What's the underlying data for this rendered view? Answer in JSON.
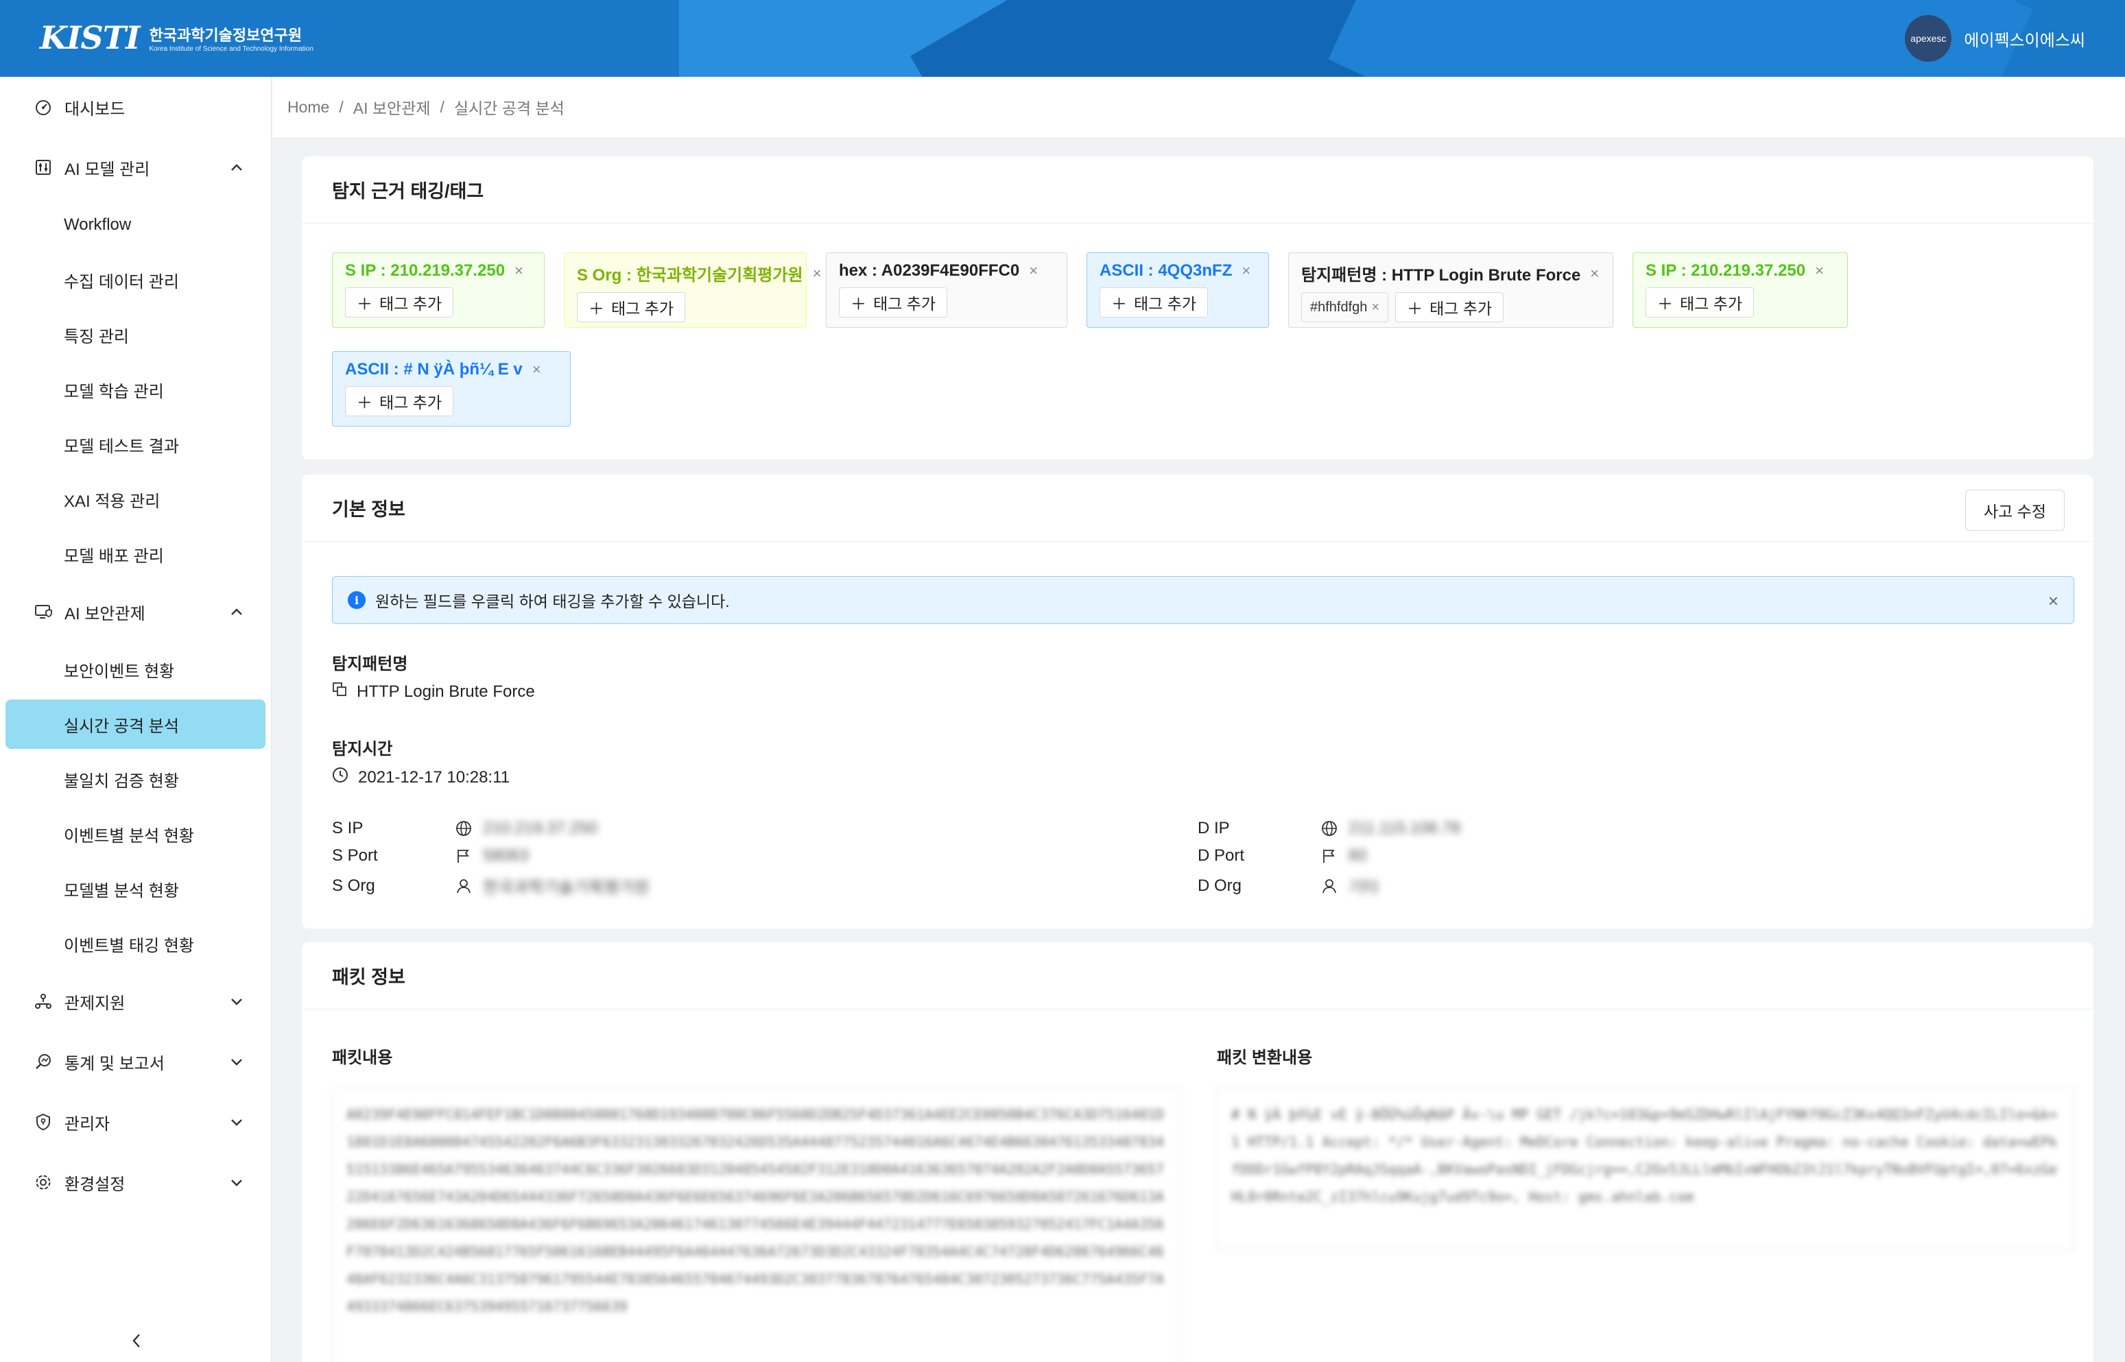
{
  "header": {
    "logo_mark": "KISTI",
    "org_ko": "한국과학기술정보연구원",
    "org_en": "Korea Institute of Science and Technology Information",
    "avatar_text": "apexesc",
    "user_name": "에이펙스이에스씨"
  },
  "sidebar": {
    "items": [
      {
        "label": "대시보드",
        "icon": "dashboard-icon"
      },
      {
        "label": "AI 모델 관리",
        "icon": "sliders-icon",
        "expanded": true,
        "children": [
          "Workflow",
          "수집 데이터 관리",
          "특징 관리",
          "모델 학습 관리",
          "모델 테스트 결과",
          "XAI 적용 관리",
          "모델 배포 관리"
        ]
      },
      {
        "label": "AI 보안관제",
        "icon": "monitor-shield-icon",
        "expanded": true,
        "children": [
          "보안이벤트 현황",
          "실시간 공격 분석",
          "불일치 검증 현황",
          "이벤트별 분석 현황",
          "모델별 분석 현황",
          "이벤트별 태깅 현황"
        ]
      },
      {
        "label": "관제지원",
        "icon": "network-icon",
        "expanded": false
      },
      {
        "label": "통계 및 보고서",
        "icon": "search-chart-icon",
        "expanded": false
      },
      {
        "label": "관리자",
        "icon": "shield-icon",
        "expanded": false
      },
      {
        "label": "환경설정",
        "icon": "gear-icon",
        "expanded": false
      }
    ],
    "active": "실시간 공격 분석"
  },
  "breadcrumb": [
    "Home",
    "AI 보안관제",
    "실시간 공격 분석"
  ],
  "tags_card": {
    "title": "탐지 근거 태깅/태그",
    "add_label": "태그 추가",
    "tags": [
      {
        "title": "S IP : 210.219.37.250",
        "color": "green"
      },
      {
        "title": "S Org : 한국과학기술기획평가원",
        "color": "yellow"
      },
      {
        "title": "hex : A0239F4E90FFC0",
        "color": "white"
      },
      {
        "title": "ASCII : 4QQ3nFZ",
        "color": "blue"
      },
      {
        "title": "탐지패턴명 : HTTP Login Brute Force",
        "color": "white",
        "chips": [
          "#hfhfdfgh"
        ]
      },
      {
        "title": "S IP : 210.219.37.250",
        "color": "green"
      },
      {
        "title": "ASCII : #  N  ÿÀ þñ¼ E v",
        "color": "blue"
      }
    ]
  },
  "basic_card": {
    "title": "기본 정보",
    "edit_label": "사고 수정",
    "alert": "원하는 필드를 우클릭 하여 태깅을 추가할 수 있습니다.",
    "pattern_label": "탐지패턴명",
    "pattern_value": "HTTP Login Brute Force",
    "time_label": "탐지시간",
    "time_value": "2021-12-17 10:28:11",
    "left": [
      {
        "k": "S IP",
        "icon": "globe-icon",
        "v": "210.219.37.250"
      },
      {
        "k": "S Port",
        "icon": "flag-icon",
        "v": "58063"
      },
      {
        "k": "S Org",
        "icon": "user-icon",
        "v": "한국과학기술기획평가원"
      }
    ],
    "right": [
      {
        "k": "D IP",
        "icon": "globe-icon",
        "v": "211.115.106.78"
      },
      {
        "k": "D Port",
        "icon": "flag-icon",
        "v": "80"
      },
      {
        "k": "D Org",
        "icon": "user-icon",
        "v": "기타"
      }
    ]
  },
  "packet_card": {
    "title": "패킷 정보",
    "content_label": "패킷내용",
    "converted_label": "패킷 변환내용",
    "content": "A0239F4E90FFC014FEF1BC1D0800450001760D1934000700C06F5560D2DB25F4D37361A4EE2CE0050B4C376CA3D7516401D1801D1E8A600004745542202F6A6B3F6332313033267032426D535A4448775235744016A6C4674E4B66304761353348783451513386E465A795534636463744C6C336F3026683D3120485454502F312E310D0A416363657074A202A2F2A0D0A557365722D4167656E743A204D65444336F72650D0A436F6E6E656374696F6E3A206B656570D2D616C6976650D0A507261676D613A206E6F2D63616368650D0A436F6F6B69653A206461746130774566E4E39444F4472314777E6503859327052417FC1A4A356F7070413D2C424B56817765F5061616BEB44495F6A464447636A72673D3D2C43324F78354A4C4C74728F4D6286764966C4648AF6232336C4A6C3137587961795544E7838564655704674493D2C3037783678764765484C3072305273736C775A435F7A4933374866EC6375394955716737756639",
    "converted": "# N ÿÀ þñ¼E vE ÿ-BÖÜ%üÕqNãP Âv-\\u MP  GET /jk?c=103&p=9mSZDHwRlIlAjFYNKf0GcZ3Kx4QQ3nFZyU4cdcILIlo=&k=1 HTTP/1.1 Accept: */* User-Agent: MeDCore Connection: keep-alive Pragma: no-cache Cookie: data=wEPkfDDDr1GwfP8Y2pRAqJSqqaA-,BKVawoPasNDI_jFDGcjrg==,C2Ox5JLLlmMbIxWFHOb23tJ1l7kpryTNxBVFUptgI=,07=6xzGeHL0r0Rnte2C_zI37hlcu9Kujg7ud9Tc9o=, Host: gms.ahnlab.com"
  }
}
